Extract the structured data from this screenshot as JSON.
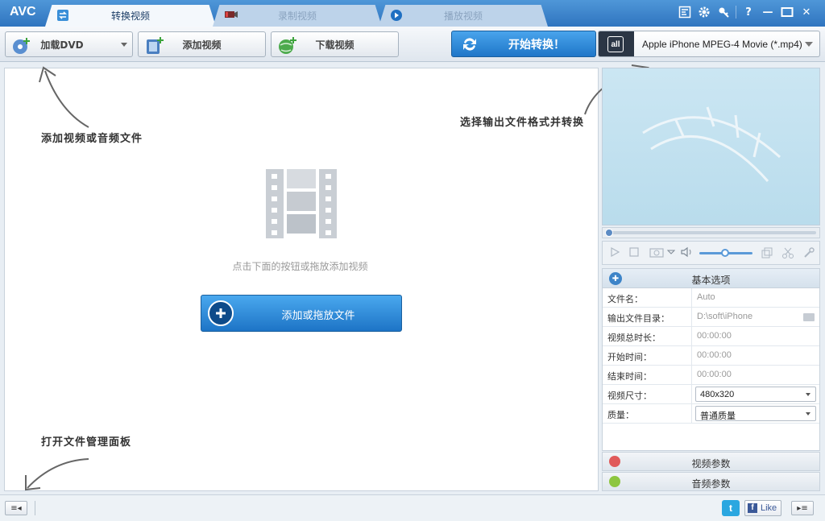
{
  "app": {
    "logo": "AVC"
  },
  "tabs": [
    {
      "label": "转换视频",
      "icon": "convert-icon",
      "active": true
    },
    {
      "label": "录制视频",
      "icon": "record-icon",
      "active": false
    },
    {
      "label": "播放视频",
      "icon": "play-icon",
      "active": false
    }
  ],
  "window_controls": {
    "icons": [
      "skin-icon",
      "gear-icon",
      "key-icon",
      "help-icon",
      "minimize-icon",
      "maximize-icon",
      "close-icon"
    ],
    "labels": {
      "help": "?",
      "minimize": "—",
      "close": "✕"
    }
  },
  "toolbar": {
    "load_dvd": "加载DVD",
    "add_video": "添加视频",
    "download_video": "下载视频",
    "start_convert": "开始转换！",
    "profile": "Apple iPhone MPEG-4 Movie (*.mp4)",
    "profile_badge": "all"
  },
  "hints": {
    "add_files": "添加视频或音频文件",
    "choose_format": "选择输出文件格式并转换",
    "open_panel": "打开文件管理面板"
  },
  "main": {
    "center_text": "点击下面的按钮或拖放添加视频",
    "drop_button": "添加或拖放文件"
  },
  "options": {
    "header": "基本选项",
    "rows": [
      {
        "label": "文件名：",
        "value": "Auto",
        "kind": "text"
      },
      {
        "label": "输出文件目录：",
        "value": "D:\\soft\\iPhone",
        "kind": "folder"
      },
      {
        "label": "视频总时长：",
        "value": "00:00:00",
        "kind": "text"
      },
      {
        "label": "开始时间：",
        "value": "00:00:00",
        "kind": "text"
      },
      {
        "label": "结束时间：",
        "value": "00:00:00",
        "kind": "text"
      },
      {
        "label": "视频尺寸：",
        "value": "480x320",
        "kind": "select"
      },
      {
        "label": "质量：",
        "value": "普通质量",
        "kind": "select"
      }
    ]
  },
  "accordions": {
    "video_params": "视频参数",
    "audio_params": "音频参数"
  },
  "statusbar": {
    "left_toggle": "≡◂",
    "right_toggle": "▸≡",
    "twitter": "t",
    "facebook_f": "f",
    "facebook_like": "Like"
  },
  "colors": {
    "title_bar": "#2f74bf",
    "accent_button": "#1f76c8",
    "preview_bg": "#cbe6f3",
    "twitter": "#2ba7e0",
    "facebook": "#3b5998"
  }
}
